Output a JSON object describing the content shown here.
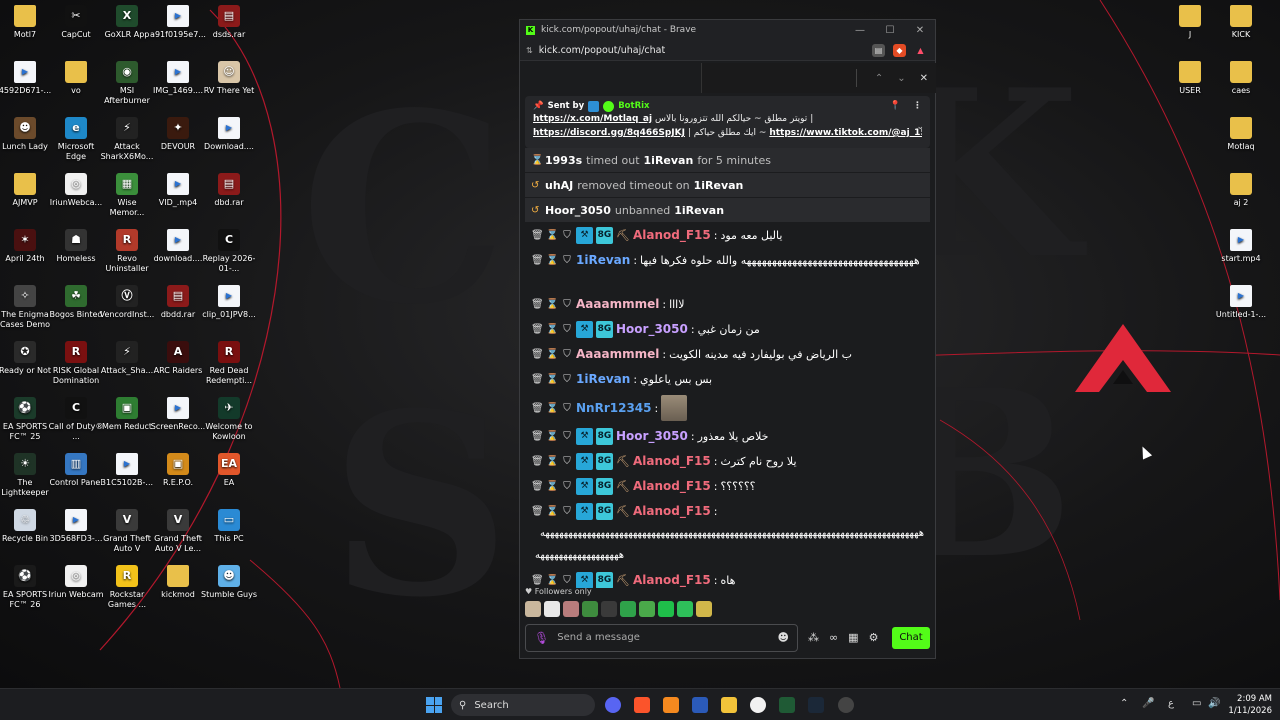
{
  "desktop_left": [
    {
      "label": "Motl7",
      "kind": "folder"
    },
    {
      "label": "CapCut",
      "kind": "app",
      "color": "#111111",
      "glyph": "✂"
    },
    {
      "label": "GoXLR App",
      "kind": "app",
      "color": "#1f4b2c",
      "glyph": "X"
    },
    {
      "label": "a91f0195e7...",
      "kind": "file"
    },
    {
      "label": "dsds.rar",
      "kind": "app",
      "color": "#8b1a1a",
      "glyph": "▤"
    },
    {
      "label": "4592D671-...",
      "kind": "file"
    },
    {
      "label": "vo",
      "kind": "folder"
    },
    {
      "label": "MSI Afterburner",
      "kind": "app",
      "color": "#2d5a2d",
      "glyph": "◉"
    },
    {
      "label": "IMG_1469....",
      "kind": "file"
    },
    {
      "label": "RV There Yet",
      "kind": "app",
      "color": "#d9c6a8",
      "glyph": "☺"
    },
    {
      "label": "Lunch Lady",
      "kind": "app",
      "color": "#6b4a2b",
      "glyph": "☻"
    },
    {
      "label": "Microsoft Edge",
      "kind": "app",
      "color": "#1e88c8",
      "glyph": "e"
    },
    {
      "label": "Attack SharkX6Mo...",
      "kind": "app",
      "color": "#222222",
      "glyph": "⚡"
    },
    {
      "label": "DEVOUR",
      "kind": "app",
      "color": "#3a1a0e",
      "glyph": "✦"
    },
    {
      "label": "Download....",
      "kind": "file"
    },
    {
      "label": "AJMVP",
      "kind": "folder"
    },
    {
      "label": "IriunWebca...",
      "kind": "app",
      "color": "#f1f1f1",
      "glyph": "◎"
    },
    {
      "label": "Wise Memor...",
      "kind": "app",
      "color": "#3b8f3b",
      "glyph": "▦"
    },
    {
      "label": "VID_.mp4",
      "kind": "file"
    },
    {
      "label": "dbd.rar",
      "kind": "app",
      "color": "#8b1a1a",
      "glyph": "▤"
    },
    {
      "label": "April 24th",
      "kind": "app",
      "color": "#4a1010",
      "glyph": "✶"
    },
    {
      "label": "Homeless",
      "kind": "app",
      "color": "#333333",
      "glyph": "☗"
    },
    {
      "label": "Revo Uninstaller",
      "kind": "app",
      "color": "#b23a2a",
      "glyph": "R"
    },
    {
      "label": "download....",
      "kind": "file"
    },
    {
      "label": "Replay 2026-01-...",
      "kind": "app",
      "color": "#111111",
      "glyph": "C"
    },
    {
      "label": "The Enigma Cases Demo",
      "kind": "app",
      "color": "#444444",
      "glyph": "✧"
    },
    {
      "label": "Bogos Binted",
      "kind": "app",
      "color": "#2f6b2f",
      "glyph": "☘"
    },
    {
      "label": "VencordInst...",
      "kind": "app",
      "color": "#222222",
      "glyph": "Ⓥ"
    },
    {
      "label": "dbdd.rar",
      "kind": "app",
      "color": "#8b1a1a",
      "glyph": "▤"
    },
    {
      "label": "clip_01JPV8...",
      "kind": "file"
    },
    {
      "label": "Ready or Not",
      "kind": "app",
      "color": "#2a2a2a",
      "glyph": "✪"
    },
    {
      "label": "RISK Global Domination",
      "kind": "app",
      "color": "#7a1010",
      "glyph": "R"
    },
    {
      "label": "Attack_Sha...",
      "kind": "app",
      "color": "#222222",
      "glyph": "⚡"
    },
    {
      "label": "ARC Raiders",
      "kind": "app",
      "color": "#3a0d0d",
      "glyph": "A"
    },
    {
      "label": "Red Dead Redempti...",
      "kind": "app",
      "color": "#7a0f0f",
      "glyph": "R"
    },
    {
      "label": "EA SPORTS FC™ 25",
      "kind": "app",
      "color": "#1b3b2a",
      "glyph": "⚽"
    },
    {
      "label": "Call of Duty® ...",
      "kind": "app",
      "color": "#111111",
      "glyph": "C"
    },
    {
      "label": "Mem Reduct",
      "kind": "app",
      "color": "#2e7d32",
      "glyph": "▣"
    },
    {
      "label": "ScreenReco...",
      "kind": "file"
    },
    {
      "label": "Welcome to Kowloon",
      "kind": "app",
      "color": "#133a2a",
      "glyph": "✈"
    },
    {
      "label": "The Lightkeeper",
      "kind": "app",
      "color": "#1f3326",
      "glyph": "☀"
    },
    {
      "label": "Control Panel",
      "kind": "app",
      "color": "#3577c2",
      "glyph": "▥"
    },
    {
      "label": "31C5102B-...",
      "kind": "file"
    },
    {
      "label": "R.E.P.O.",
      "kind": "app",
      "color": "#d38a1a",
      "glyph": "▣"
    },
    {
      "label": "EA",
      "kind": "app",
      "color": "#e2572b",
      "glyph": "EA"
    },
    {
      "label": "Recycle Bin",
      "kind": "app",
      "color": "#cfd8e3",
      "glyph": "♲"
    },
    {
      "label": "3D568FD3-...",
      "kind": "file"
    },
    {
      "label": "Grand Theft Auto V",
      "kind": "app",
      "color": "#3a3a3a",
      "glyph": "V"
    },
    {
      "label": "Grand Theft Auto V Le...",
      "kind": "app",
      "color": "#3a3a3a",
      "glyph": "V"
    },
    {
      "label": "This PC",
      "kind": "app",
      "color": "#2a8ad4",
      "glyph": "▭"
    },
    {
      "label": "EA SPORTS FC™ 26",
      "kind": "app",
      "color": "#1a1a1a",
      "glyph": "⚽"
    },
    {
      "label": "Iriun Webcam",
      "kind": "app",
      "color": "#f1f1f1",
      "glyph": "◎"
    },
    {
      "label": "Rockstar Games ...",
      "kind": "app",
      "color": "#f2c21a",
      "glyph": "R"
    },
    {
      "label": "kickmod",
      "kind": "folder"
    },
    {
      "label": "Stumble Guys",
      "kind": "app",
      "color": "#5fb0e8",
      "glyph": "☻"
    }
  ],
  "desktop_right": [
    {
      "label": "J",
      "kind": "folder"
    },
    {
      "label": "KICK",
      "kind": "folder"
    },
    {
      "label": "USER",
      "kind": "folder"
    },
    {
      "label": "caes",
      "kind": "folder"
    },
    {
      "label": "Motlaq",
      "kind": "folder"
    },
    {
      "label": "aj 2",
      "kind": "folder"
    },
    {
      "label": "start.mp4",
      "kind": "file"
    },
    {
      "label": "Untitled-1-...",
      "kind": "file"
    }
  ],
  "browser": {
    "title": "kick.com/popout/uhaj/chat - Brave",
    "url": "kick.com/popout/uhaj/chat"
  },
  "pinned": {
    "sent_by": "Sent by",
    "bot": "BotRix",
    "line1_text": "تويتر مطلق ~ حيالكم الله تتزورونا بالاس |",
    "line1_link": "https://x.com/Motlaq_aj",
    "line2_link1": "https://discord.gg/8q466SpJKJ",
    "line2_mid": "| ايك مطلق حياكم ~",
    "line2_link2": "https://www.tiktok.com/@aj_155..."
  },
  "system_msgs": [
    {
      "actor": "1993s",
      "action": "timed out",
      "target": "1iRevan",
      "suffix": "for 5 minutes",
      "icon": "hourglass"
    },
    {
      "actor": "uhAJ",
      "action": "removed timeout on",
      "target": "1iRevan",
      "suffix": "",
      "icon": "undo"
    },
    {
      "actor": "Hoor_3050",
      "action": "unbanned",
      "target": "1iRevan",
      "suffix": "",
      "icon": "undo"
    }
  ],
  "messages": [
    {
      "user": "Alanod_F15",
      "color": "#f06b7c",
      "badges": true,
      "pick": true,
      "text": "ياليل معه مود"
    },
    {
      "user": "1iRevan",
      "color": "#6aa8ff",
      "badges": false,
      "pick": false,
      "text": "ههههههههههههههههههههههههههههههههههه والله حلوه فكرها فيها",
      "tall": true
    },
    {
      "user": "Aaaammmel",
      "color": "#f5b5c6",
      "badges": false,
      "pick": false,
      "text": "لاااا"
    },
    {
      "user": "Hoor_3050",
      "color": "#c8a0ff",
      "badges": true,
      "pick": false,
      "text": "من زمان غبي"
    },
    {
      "user": "Aaaammmel",
      "color": "#f5b5c6",
      "badges": false,
      "pick": false,
      "text": "ب الرياض في بوليفارد فيه مدينه الكويت"
    },
    {
      "user": "1iRevan",
      "color": "#6aa8ff",
      "badges": false,
      "pick": false,
      "text": "بس بس ياعلوي"
    },
    {
      "user": "NnRr12345",
      "color": "#5aa0f0",
      "badges": false,
      "pick": false,
      "text": "",
      "emote": true
    },
    {
      "user": "Hoor_3050",
      "color": "#c8a0ff",
      "badges": true,
      "pick": false,
      "text": "خلاص يلا معذور"
    },
    {
      "user": "Alanod_F15",
      "color": "#f06b7c",
      "badges": true,
      "pick": true,
      "text": "يلا روح نام كترث"
    },
    {
      "user": "Alanod_F15",
      "color": "#f06b7c",
      "badges": true,
      "pick": true,
      "text": "؟؟؟؟؟؟"
    },
    {
      "user": "Alanod_F15",
      "color": "#f06b7c",
      "badges": true,
      "pick": true,
      "text": "",
      "wide": "ههههههههههههههههههههههههههههههههههههههههههههههههههههههههههههههههههههههههههههههههههه",
      "wide2": "ههههههههههههههههههه"
    },
    {
      "user": "Alanod_F15",
      "color": "#f06b7c",
      "badges": true,
      "pick": true,
      "text": "هاه"
    }
  ],
  "followers_only": "Followers only",
  "input_placeholder": "Send a message",
  "chat_button": "Chat",
  "taskbar": {
    "search": "Search",
    "time": "2:09 AM",
    "date": "1/11/2026",
    "lang": "ع"
  },
  "colors": {
    "kick_green": "#53fc18",
    "accent_red": "#e0283a"
  }
}
